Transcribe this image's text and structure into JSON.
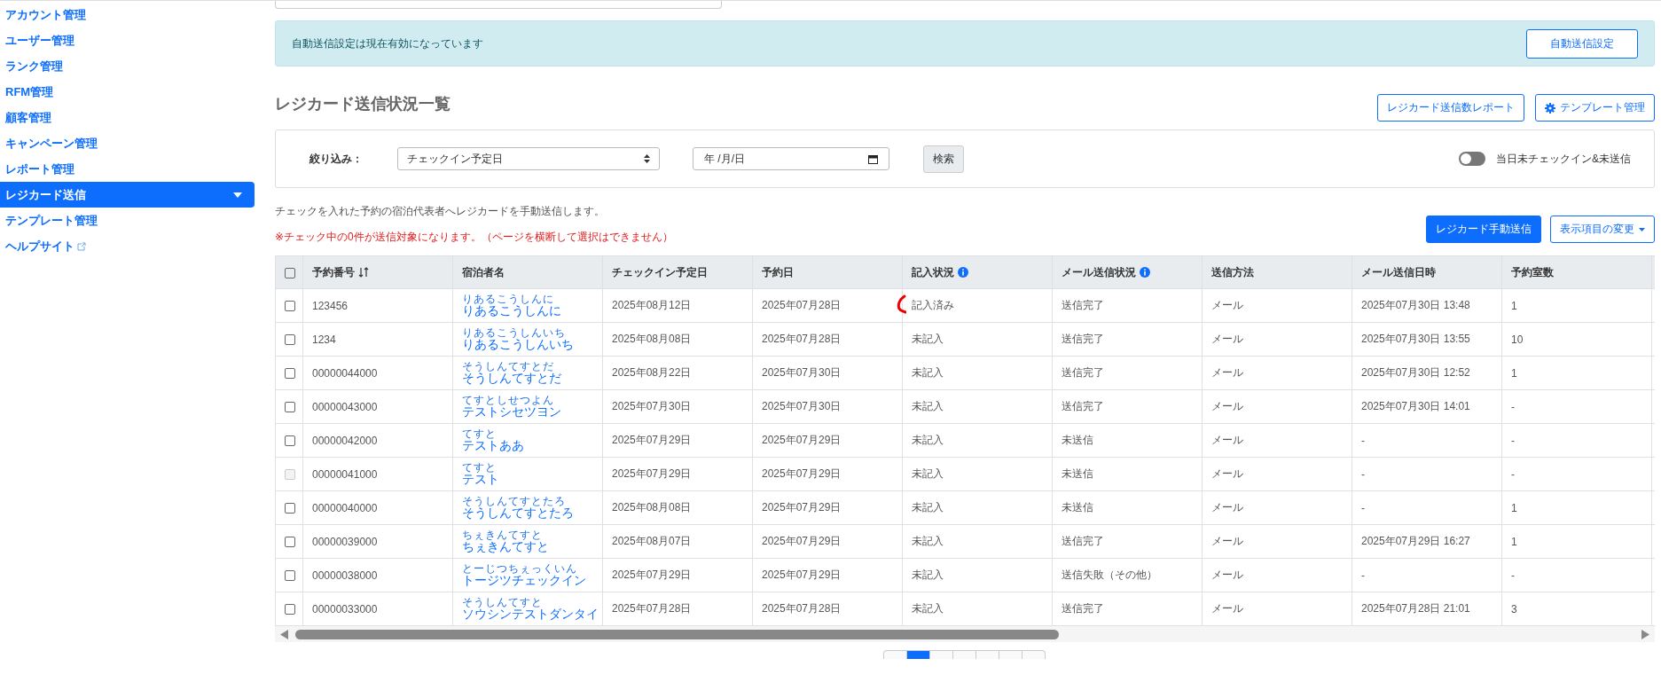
{
  "sidebar": {
    "items": [
      {
        "label": "アカウント管理",
        "selected": false,
        "kind": "link"
      },
      {
        "label": "ユーザー管理",
        "selected": false,
        "kind": "link"
      },
      {
        "label": "ランク管理",
        "selected": false,
        "kind": "link"
      },
      {
        "label": "RFM管理",
        "selected": false,
        "kind": "link"
      },
      {
        "label": "顧客管理",
        "selected": false,
        "kind": "link"
      },
      {
        "label": "キャンペーン管理",
        "selected": false,
        "kind": "link"
      },
      {
        "label": "レポート管理",
        "selected": false,
        "kind": "link"
      },
      {
        "label": "レジカード送信",
        "selected": true,
        "kind": "menu"
      },
      {
        "label": "テンプレート管理",
        "selected": false,
        "kind": "link"
      },
      {
        "label": "ヘルプサイト",
        "selected": false,
        "kind": "external"
      }
    ]
  },
  "alert": {
    "message": "自動送信設定は現在有効になっています",
    "button": "自動送信設定"
  },
  "page_title": "レジカード送信状況一覧",
  "header_buttons": [
    {
      "label": "レジカード送信数レポート",
      "kind": "plain"
    },
    {
      "label": "テンプレート管理",
      "kind": "gear"
    }
  ],
  "filter": {
    "label": "絞り込み：",
    "select_value": "チェックイン予定日",
    "date_value": "年 /月/日",
    "search_button": "検索",
    "toggle": {
      "label": "当日未チェックイン&未送信",
      "on": false
    }
  },
  "notes": {
    "info": "チェックを入れた予約の宿泊代表者へレジカードを手動送信します。",
    "warning": "※チェック中の0件が送信対象になります。（ページを横断して選択はできません）"
  },
  "action_buttons": [
    {
      "label": "レジカード手動送信",
      "kind": "primary"
    },
    {
      "label": "表示項目の変更",
      "kind": "dropdown"
    }
  ],
  "table": {
    "select_all": {
      "checked": false
    },
    "columns": [
      {
        "label": "予約番号",
        "kind": "sortable"
      },
      {
        "label": "宿泊者名",
        "kind": "plain"
      },
      {
        "label": "チェックイン予定日",
        "kind": "plain"
      },
      {
        "label": "予約日",
        "kind": "plain"
      },
      {
        "label": "記入状況",
        "kind": "help"
      },
      {
        "label": "メール送信状況",
        "kind": "help"
      },
      {
        "label": "送信方法",
        "kind": "plain"
      },
      {
        "label": "メール送信日時",
        "kind": "plain"
      },
      {
        "label": "予約室数",
        "kind": "plain"
      }
    ],
    "rows": [
      {
        "checked": false,
        "disabled": false,
        "cells": [
          "123456",
          "りあるこうしんに",
          "2025年08月12日",
          "2025年07月28日",
          "記入済み",
          "送信完了",
          "メール",
          "2025年07月30日 13:48",
          "1"
        ],
        "reading": "りあるこうしんに"
      },
      {
        "checked": false,
        "disabled": false,
        "cells": [
          "1234",
          "りあるこうしんいち",
          "2025年08月08日",
          "2025年07月28日",
          "未記入",
          "送信完了",
          "メール",
          "2025年07月30日 13:55",
          "10"
        ],
        "reading": "りあるこうしんいち"
      },
      {
        "checked": false,
        "disabled": false,
        "cells": [
          "00000044000",
          "そうしんてすとだ",
          "2025年08月22日",
          "2025年07月30日",
          "未記入",
          "送信完了",
          "メール",
          "2025年07月30日 12:52",
          "1"
        ],
        "reading": "そうしんてすとだ"
      },
      {
        "checked": false,
        "disabled": false,
        "cells": [
          "00000043000",
          "テストシセツヨン",
          "2025年07月30日",
          "2025年07月30日",
          "未記入",
          "送信完了",
          "メール",
          "2025年07月30日 14:01",
          "-"
        ],
        "reading": "てすとしせつよん"
      },
      {
        "checked": false,
        "disabled": false,
        "cells": [
          "00000042000",
          "テストああ",
          "2025年07月29日",
          "2025年07月29日",
          "未記入",
          "未送信",
          "メール",
          "-",
          "-"
        ],
        "reading": "てすと"
      },
      {
        "checked": false,
        "disabled": true,
        "cells": [
          "00000041000",
          "テスト",
          "2025年07月29日",
          "2025年07月29日",
          "未記入",
          "未送信",
          "メール",
          "-",
          "-"
        ],
        "reading": "てすと"
      },
      {
        "checked": false,
        "disabled": false,
        "cells": [
          "00000040000",
          "そうしんてすとたろ",
          "2025年08月08日",
          "2025年07月29日",
          "未記入",
          "未送信",
          "メール",
          "-",
          "1"
        ],
        "reading": "そうしんてすとたろ"
      },
      {
        "checked": false,
        "disabled": false,
        "cells": [
          "00000039000",
          "ちぇきんてすと",
          "2025年08月07日",
          "2025年07月29日",
          "未記入",
          "送信完了",
          "メール",
          "2025年07月29日 16:27",
          "1"
        ],
        "reading": "ちぇきんてすと"
      },
      {
        "checked": false,
        "disabled": false,
        "cells": [
          "00000038000",
          "トージツチェックイン",
          "2025年07月29日",
          "2025年07月29日",
          "未記入",
          "送信失敗（その他）",
          "メール",
          "-",
          "-"
        ],
        "reading": "とーじつちぇっくいん"
      },
      {
        "checked": false,
        "disabled": false,
        "cells": [
          "00000033000",
          "ソウシンテストダンタイ",
          "2025年07月28日",
          "2025年07月28日",
          "未記入",
          "送信完了",
          "メール",
          "2025年07月28日 21:01",
          "3"
        ],
        "reading": "そうしんてすと"
      }
    ]
  },
  "pagination": [
    {
      "selected": false
    },
    {
      "selected": true
    },
    {
      "selected": false
    },
    {
      "selected": false
    },
    {
      "selected": false
    },
    {
      "selected": false
    },
    {
      "selected": false
    }
  ]
}
